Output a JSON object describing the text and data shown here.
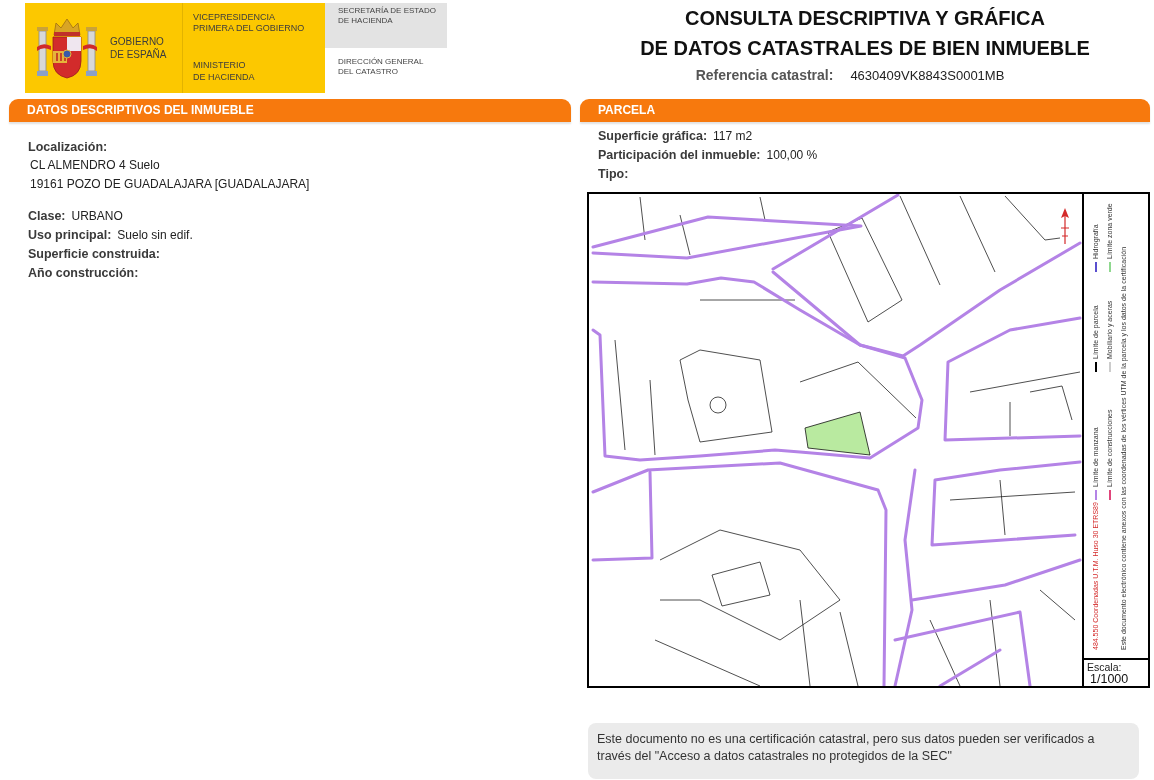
{
  "header": {
    "logo": {
      "government": [
        "GOBIERNO",
        "DE ESPAÑA"
      ],
      "vice_presidency": [
        "VICEPRESIDENCIA",
        "PRIMERA DEL GOBIERNO"
      ],
      "ministry": [
        "MINISTERIO",
        "DE HACIENDA"
      ],
      "secretariat": [
        "SECRETARÍA DE ESTADO",
        "DE HACIENDA"
      ],
      "directorate": [
        "DIRECCIÓN GENERAL",
        "DEL CATASTRO"
      ]
    },
    "title": [
      "CONSULTA DESCRIPTIVA Y GRÁFICA",
      "DE DATOS CATASTRALES DE BIEN INMUEBLE"
    ],
    "reference": {
      "label": "Referencia catastral:",
      "value": "4630409VK8843S0001MB"
    }
  },
  "descriptive": {
    "title": "DATOS DESCRIPTIVOS DEL INMUEBLE",
    "location": {
      "label": "Localización:",
      "lines": [
        "CL ALMENDRO 4 Suelo",
        "19161 POZO DE GUADALAJARA [GUADALAJARA]"
      ]
    },
    "fields": [
      {
        "label": "Clase:",
        "value": "URBANO"
      },
      {
        "label": "Uso principal:",
        "value": "Suelo sin edif."
      },
      {
        "label": "Superficie construida:"
      },
      {
        "label": "Año construcción:"
      }
    ]
  },
  "parcel": {
    "title": "PARCELA",
    "fields": [
      {
        "label": "Superficie gráfica:",
        "value": "117 m2"
      },
      {
        "label": "Participación del inmueble:",
        "value": "100,00 %"
      },
      {
        "label": "Tipo:"
      }
    ],
    "map": {
      "legend": {
        "coordinates": "484.550 Coordenadas U.T.M. Huso 30 ETRS89",
        "rows": [
          {
            "items": [
              {
                "label": "Límite de manzana",
                "color": "#b483e6"
              },
              {
                "label": "Límite de parcela",
                "color": "#000000"
              },
              {
                "label": "Hidrografía",
                "color": "#5a4fcf"
              }
            ]
          },
          {
            "items": [
              {
                "label": "Límite de construcciones",
                "color": "#e0457b"
              },
              {
                "label": "Mobiliario y aceras",
                "color": "#cccccc"
              },
              {
                "label": "Límite zona verde",
                "color": "#8fd88f"
              }
            ]
          }
        ],
        "note": "Este documento electrónico contiene anexos con las coordenadas de los vértices UTM de la parcela y los datos de la certificación"
      },
      "scale": {
        "label": "Escala:",
        "value": "1/1000"
      }
    }
  },
  "notice": "Este documento no es una certificación catastral, pero sus datos pueden ser verificados a través del \"Acceso a datos catastrales no protegidos de la SEC\""
}
